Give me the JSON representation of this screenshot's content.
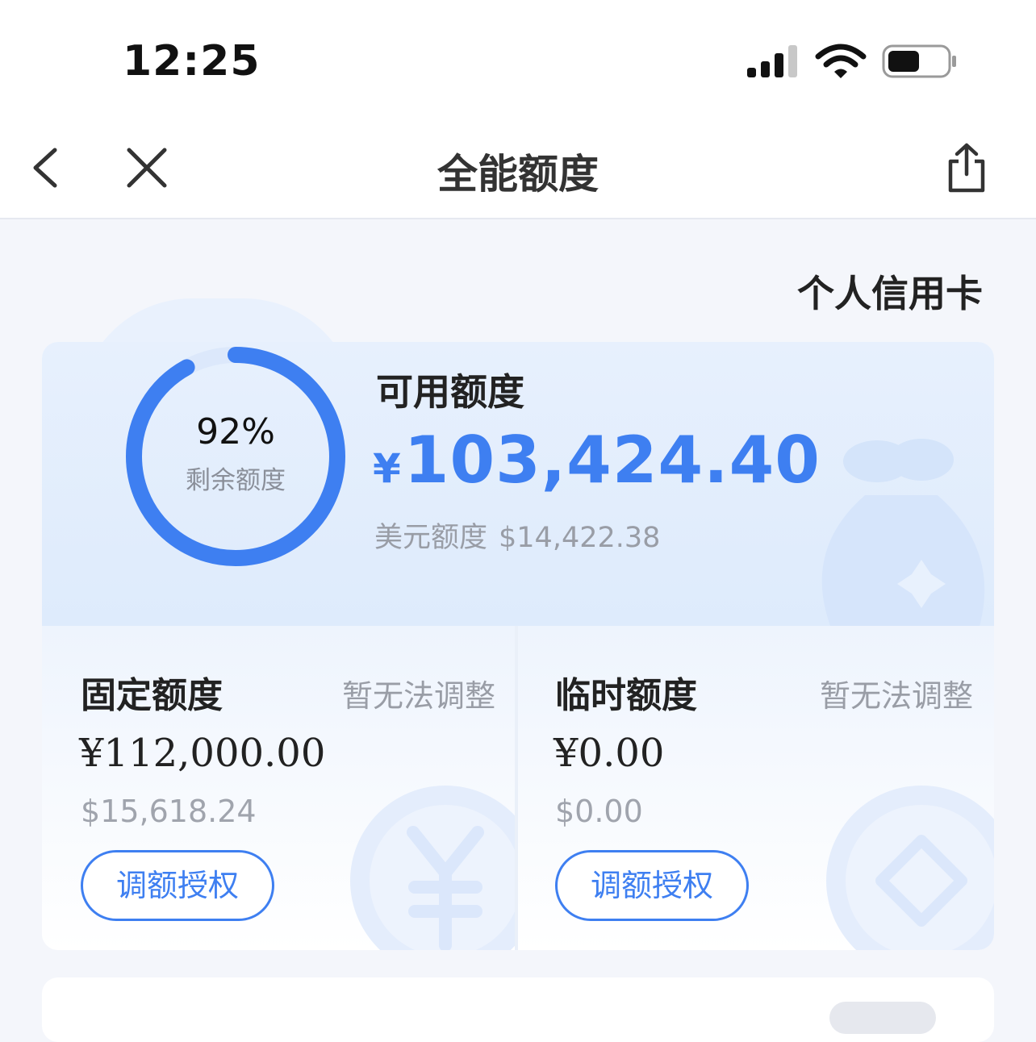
{
  "status_bar": {
    "time": "12:25"
  },
  "nav": {
    "title": "全能额度"
  },
  "account": {
    "label": "个人信用卡"
  },
  "summary": {
    "ring_percent": "92%",
    "ring_fraction": 0.92,
    "ring_caption": "剩余额度",
    "available_label": "可用额度",
    "currency_symbol": "¥",
    "available_amount": "103,424.40",
    "usd_label": "美元额度",
    "usd_amount": "$14,422.38"
  },
  "fixed_limit": {
    "title": "固定额度",
    "status": "暂无法调整",
    "amount": "¥112,000.00",
    "usd": "$15,618.24",
    "button": "调额授权"
  },
  "temp_limit": {
    "title": "临时额度",
    "status": "暂无法调整",
    "amount": "¥0.00",
    "usd": "$0.00",
    "button": "调额授权"
  },
  "colors": {
    "accent": "#3e7ff1",
    "ring_track": "#dce8fb"
  }
}
